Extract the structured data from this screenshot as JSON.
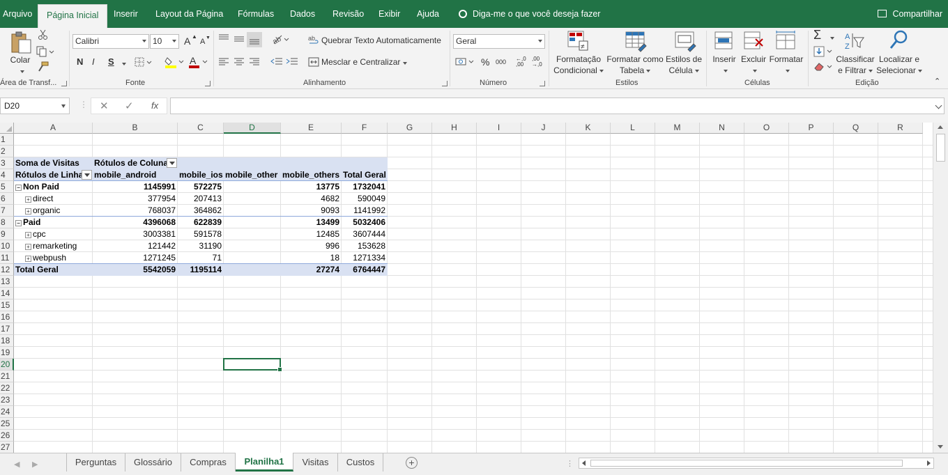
{
  "ribbon_tabs": [
    "Arquivo",
    "Página Inicial",
    "Inserir",
    "Layout da Página",
    "Fórmulas",
    "Dados",
    "Revisão",
    "Exibir",
    "Ajuda"
  ],
  "active_tab": "Página Inicial",
  "tell_me": "Diga-me o que você deseja fazer",
  "share": "Compartilhar",
  "colors": {
    "accent": "#217346",
    "pivot_header": "#d9e1f2",
    "pivot_line": "#8ea9db",
    "font_color": "#c00000",
    "highlight": "#ffff00"
  },
  "clipboard": {
    "paste": "Colar",
    "label": "Área de Transf..."
  },
  "font": {
    "name": "Calibri",
    "size": "10",
    "label": "Fonte",
    "bold": "N",
    "italic": "I",
    "underline": "S",
    "grow": "A",
    "shrink": "A"
  },
  "alignment": {
    "wrap": "Quebrar Texto Automaticamente",
    "merge": "Mesclar e Centralizar",
    "label": "Alinhamento"
  },
  "number": {
    "format": "Geral",
    "label": "Número",
    "percent": "%",
    "thousands": "000",
    "inc_dec": ",0 ,00",
    "dec_dec": ",00 ,0"
  },
  "styles": {
    "conditional": [
      "Formatação",
      "Condicional"
    ],
    "table": [
      "Formatar como",
      "Tabela"
    ],
    "cell": [
      "Estilos de",
      "Célula"
    ],
    "label": "Estilos"
  },
  "cells": {
    "insert": "Inserir",
    "delete": "Excluir",
    "format": "Formatar",
    "label": "Células"
  },
  "editing": {
    "sort": [
      "Classificar",
      "e Filtrar"
    ],
    "find": [
      "Localizar e",
      "Selecionar"
    ],
    "label": "Edição",
    "sum": "Σ"
  },
  "formula_bar": {
    "name_box": "D20",
    "cancel": "✕",
    "enter": "✓",
    "fx": "fx",
    "content": ""
  },
  "columns": [
    "A",
    "B",
    "C",
    "D",
    "E",
    "F",
    "G",
    "H",
    "I",
    "J",
    "K",
    "L",
    "M",
    "N",
    "O",
    "P",
    "Q",
    "R"
  ],
  "rows": [
    "1",
    "2",
    "3",
    "4",
    "5",
    "6",
    "7",
    "8",
    "9",
    "10",
    "11",
    "12",
    "13",
    "14",
    "15",
    "16",
    "17",
    "18",
    "19",
    "20",
    "21",
    "22",
    "23",
    "24",
    "25",
    "26",
    "27"
  ],
  "selected_cell": "D20",
  "pivot": {
    "value_label": "Soma de Visitas",
    "col_labels_header": "Rótulos de Coluna",
    "row_labels_header": "Rótulos de Linha",
    "col_headers": [
      "mobile_android",
      "mobile_ios",
      "mobile_other",
      "mobile_others",
      "Total Geral"
    ],
    "rows": [
      {
        "label": "Non Paid",
        "level": 0,
        "toggle": "⊟",
        "values": [
          "1145991",
          "572275",
          "",
          "13775",
          "1732041"
        ]
      },
      {
        "label": "direct",
        "level": 1,
        "toggle": "⊞",
        "values": [
          "377954",
          "207413",
          "",
          "4682",
          "590049"
        ]
      },
      {
        "label": "organic",
        "level": 1,
        "toggle": "⊞",
        "values": [
          "768037",
          "364862",
          "",
          "9093",
          "1141992"
        ]
      },
      {
        "label": "Paid",
        "level": 0,
        "toggle": "⊟",
        "values": [
          "4396068",
          "622839",
          "",
          "13499",
          "5032406"
        ]
      },
      {
        "label": "cpc",
        "level": 1,
        "toggle": "⊞",
        "values": [
          "3003381",
          "591578",
          "",
          "12485",
          "3607444"
        ]
      },
      {
        "label": "remarketing",
        "level": 1,
        "toggle": "⊞",
        "values": [
          "121442",
          "31190",
          "",
          "996",
          "153628"
        ]
      },
      {
        "label": "webpush",
        "level": 1,
        "toggle": "⊞",
        "values": [
          "1271245",
          "71",
          "",
          "18",
          "1271334"
        ]
      }
    ],
    "grand_total": {
      "label": "Total Geral",
      "values": [
        "5542059",
        "1195114",
        "",
        "27274",
        "6764447"
      ]
    }
  },
  "sheets": [
    "Perguntas",
    "Glossário",
    "Compras",
    "Planilha1",
    "Visitas",
    "Custos"
  ],
  "active_sheet": "Planilha1"
}
